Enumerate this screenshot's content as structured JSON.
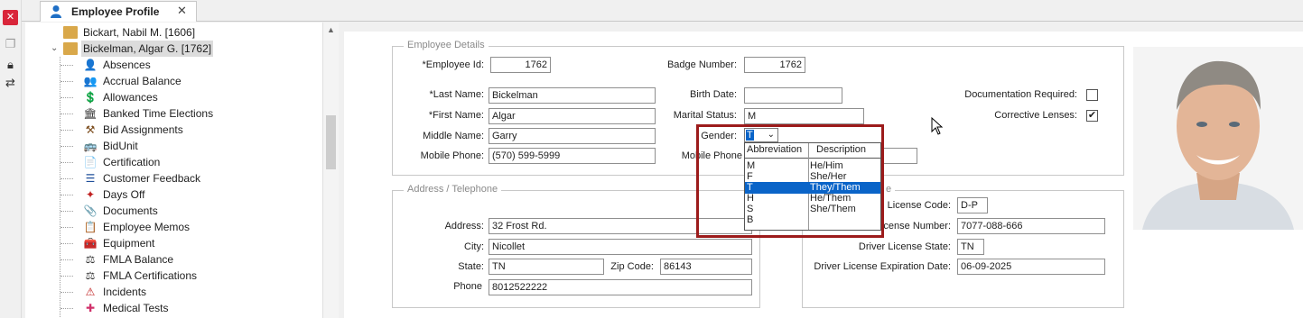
{
  "tab": {
    "title": "Employee Profile",
    "close": "✕"
  },
  "tree": {
    "employees": [
      {
        "label": "Bickart, Nabil M. [1606]"
      },
      {
        "label": "Bickelman, Algar G. [1762]"
      }
    ],
    "items": [
      {
        "label": "Absences",
        "icon": "absences-icon"
      },
      {
        "label": "Accrual Balance",
        "icon": "accrual-balance-icon"
      },
      {
        "label": "Allowances",
        "icon": "allowances-icon"
      },
      {
        "label": "Banked Time Elections",
        "icon": "bank-icon"
      },
      {
        "label": "Bid Assignments",
        "icon": "bid-assignments-icon"
      },
      {
        "label": "BidUnit",
        "icon": "bidunit-icon"
      },
      {
        "label": "Certification",
        "icon": "certification-icon"
      },
      {
        "label": "Customer Feedback",
        "icon": "customer-feedback-icon"
      },
      {
        "label": "Days Off",
        "icon": "days-off-icon"
      },
      {
        "label": "Documents",
        "icon": "paperclip-icon"
      },
      {
        "label": "Employee Memos",
        "icon": "memo-icon"
      },
      {
        "label": "Equipment",
        "icon": "toolbox-icon"
      },
      {
        "label": "FMLA Balance",
        "icon": "fmla-balance-icon"
      },
      {
        "label": "FMLA Certifications",
        "icon": "fmla-certifications-icon"
      },
      {
        "label": "Incidents",
        "icon": "warning-icon"
      },
      {
        "label": "Medical Tests",
        "icon": "medical-icon"
      }
    ]
  },
  "details": {
    "legend": "Employee Details",
    "employee_id_label": "*Employee Id:",
    "employee_id": "1762",
    "badge_label": "Badge Number:",
    "badge": "1762",
    "last_name_label": "*Last Name:",
    "last_name": "Bickelman",
    "first_name_label": "*First Name:",
    "first_name": "Algar",
    "middle_name_label": "Middle Name:",
    "middle_name": "Garry",
    "mobile_label": "Mobile Phone:",
    "mobile": "(570) 599-5999",
    "birth_date_label": "Birth Date:",
    "birth_date": "",
    "marital_label": "Marital Status:",
    "marital": "M",
    "gender_label": "Gender:",
    "gender": "T",
    "mobile2_label": "Mobile Phone",
    "doc_required_label": "Documentation Required:",
    "doc_required": false,
    "corrective_label": "Corrective Lenses:",
    "corrective": true
  },
  "address": {
    "legend": "Address / Telephone",
    "address_label": "Address:",
    "address": "32 Frost Rd.",
    "city_label": "City:",
    "city": "Nicollet",
    "state_label": "State:",
    "state": "TN",
    "zip_label": "Zip Code:",
    "zip": "86143",
    "phone_label": "Phone",
    "phone": "8012522222"
  },
  "license": {
    "legend_fragment": "e",
    "code_label": "License Code:",
    "code": "D-P",
    "number_label": "cense Number:",
    "number": "7077-088-666",
    "state_label": "Driver License State:",
    "state": "TN",
    "exp_label": "Driver License Expiration Date:",
    "exp": "06-09-2025"
  },
  "gender_dropdown": {
    "col_abbrev": "Abbreviation",
    "col_desc": "Description",
    "rows": [
      {
        "abbr": "M",
        "desc": "He/Him"
      },
      {
        "abbr": "F",
        "desc": "She/Her"
      },
      {
        "abbr": "T",
        "desc": "They/Them"
      },
      {
        "abbr": "H",
        "desc": "He/Them"
      },
      {
        "abbr": "S",
        "desc": "She/Them"
      },
      {
        "abbr": "B",
        "desc": ""
      }
    ],
    "highlighted_index": 2
  },
  "colors": {
    "highlight": "#0a64c8",
    "frame": "#9c1b1b"
  }
}
